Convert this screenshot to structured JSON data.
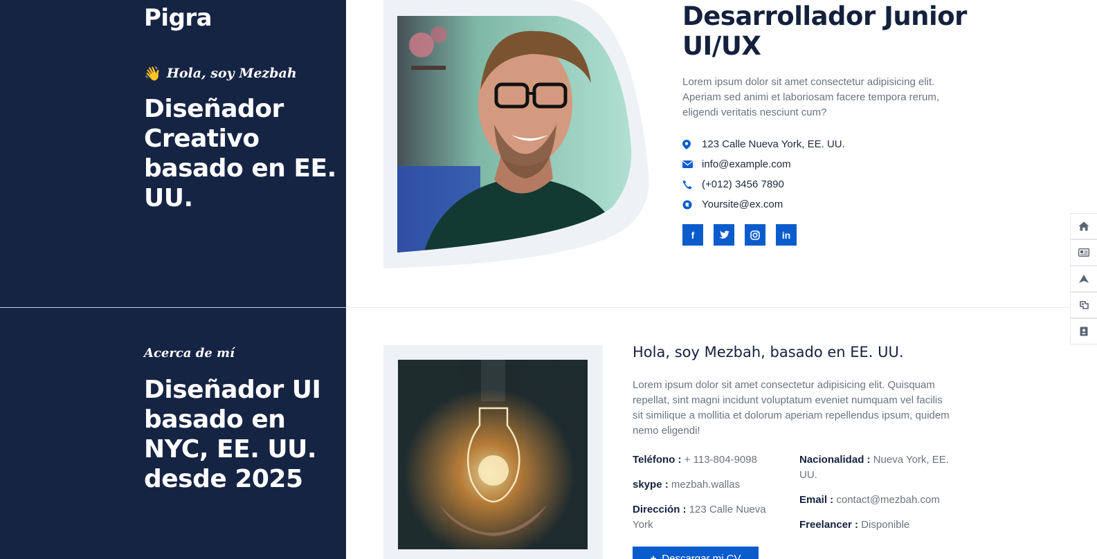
{
  "hero": {
    "brand": "Pigra",
    "greeting": "Hola, soy Mezbah",
    "greeting_emoji": "👋",
    "title": "Diseñador Creativo basado en EE. UU."
  },
  "profile": {
    "job_title": "Desarrollador Junior UI/UX",
    "description": "Lorem ipsum dolor sit amet consectetur adipisicing elit. Aperiam sed animi et laboriosam facere tempora rerum, eligendi veritatis nesciunt cum?",
    "contacts": [
      {
        "icon": "map-pin-icon",
        "text": "123 Calle Nueva York, EE. UU."
      },
      {
        "icon": "envelope-icon",
        "text": "info@example.com"
      },
      {
        "icon": "phone-icon",
        "text": "(+012) 3456 7890"
      },
      {
        "icon": "globe-icon",
        "text": "Yoursite@ex.com"
      }
    ],
    "socials": [
      {
        "icon": "facebook-icon",
        "glyph": "f"
      },
      {
        "icon": "twitter-icon",
        "glyph": ""
      },
      {
        "icon": "instagram-icon",
        "glyph": ""
      },
      {
        "icon": "linkedin-icon",
        "glyph": "in"
      }
    ]
  },
  "about": {
    "kicker": "Acerca de mí",
    "title": "Diseñador UI basado en NYC, EE. UU. desde 2025",
    "heading": "Hola, soy Mezbah, basado en EE. UU.",
    "description": "Lorem ipsum dolor sit amet consectetur adipisicing elit. Quisquam repellat, sint magni incidunt voluptatum eveniet numquam vel facilis sit similique a mollitia et dolorum aperiam repellendus ipsum, quidem nemo eligendi!",
    "info_left": [
      {
        "label": "Teléfono :",
        "value": "+ 113-804-9098"
      },
      {
        "label": "skype :",
        "value": "mezbah.wallas"
      },
      {
        "label": "Dirección :",
        "value": "123 Calle Nueva York"
      }
    ],
    "info_right": [
      {
        "label": "Nacionalidad :",
        "value": "Nueva York, EE. UU."
      },
      {
        "label": "Email :",
        "value": "contact@mezbah.com"
      },
      {
        "label": "Freelancer :",
        "value": "Disponible"
      }
    ],
    "cv_button": "Descargar mi CV"
  },
  "sidenav": [
    "home-icon",
    "id-card-icon",
    "send-icon",
    "briefcase-icon",
    "contact-book-icon"
  ],
  "colors": {
    "sidebar_bg": "#162444",
    "accent": "#0a5ccc",
    "heading": "#14213d",
    "muted": "#6c7280"
  }
}
